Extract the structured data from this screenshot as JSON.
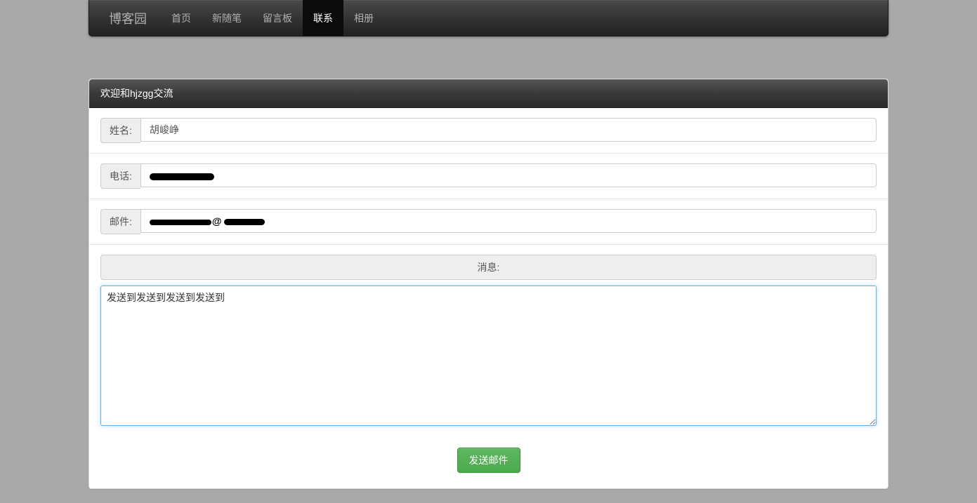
{
  "nav": {
    "brand": "博客园",
    "items": [
      {
        "label": "首页",
        "active": false
      },
      {
        "label": "新随笔",
        "active": false
      },
      {
        "label": "留言板",
        "active": false
      },
      {
        "label": "联系",
        "active": true
      },
      {
        "label": "相册",
        "active": false
      }
    ]
  },
  "panel": {
    "title": "欢迎和hjzgg交流"
  },
  "form": {
    "name_label": "姓名:",
    "name_value": "胡峻峥",
    "phone_label": "电话:",
    "phone_masked": true,
    "email_label": "邮件:",
    "email_masked": true,
    "message_label": "消息:",
    "message_value": "发送到发送到发送到发送到",
    "submit_label": "发送邮件"
  }
}
